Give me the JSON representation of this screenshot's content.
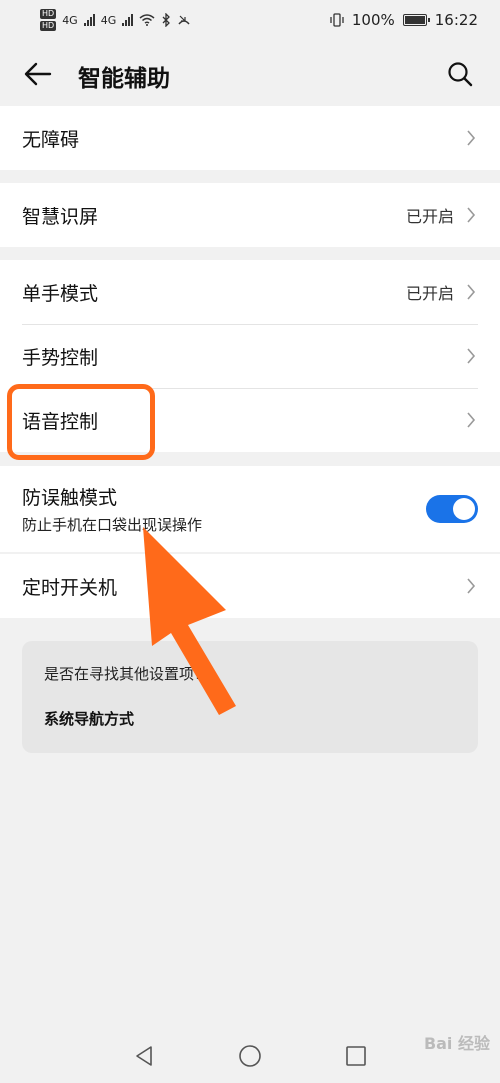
{
  "status": {
    "network_left": "4G",
    "network_right": "4G",
    "hd_top": "HD",
    "hd_bottom": "HD",
    "battery": "100%",
    "time": "16:22"
  },
  "header": {
    "title": "智能辅助",
    "back_icon": "back-arrow-icon",
    "search_icon": "search-icon"
  },
  "items": {
    "accessibility": {
      "label": "无障碍"
    },
    "smart_screen": {
      "label": "智慧识屏",
      "value": "已开启"
    },
    "one_hand": {
      "label": "单手模式",
      "value": "已开启"
    },
    "gesture": {
      "label": "手势控制"
    },
    "voice": {
      "label": "语音控制"
    },
    "anti_touch": {
      "label": "防误触模式",
      "sub": "防止手机在口袋出现误操作",
      "toggle_on": true
    },
    "timer_power": {
      "label": "定时开关机"
    }
  },
  "suggest": {
    "question": "是否在寻找其他设置项?",
    "link": "系统导航方式"
  },
  "colors": {
    "accent": "#1a73e8",
    "annotation": "#ff6a1a"
  },
  "watermark": "Bai 经验"
}
